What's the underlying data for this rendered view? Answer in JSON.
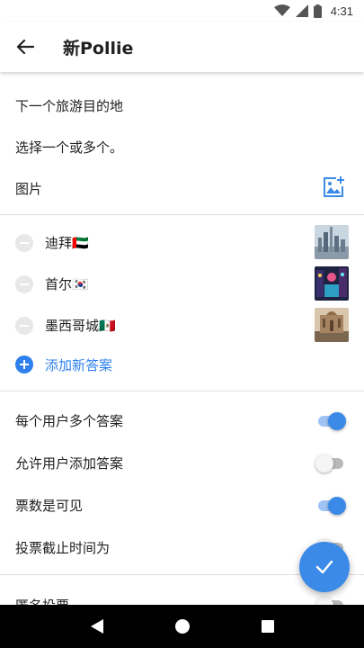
{
  "status_bar": {
    "time": "4:31",
    "icons": [
      "wifi-icon",
      "signal-icon",
      "battery-icon"
    ]
  },
  "app_bar": {
    "title": "新Pollie",
    "back_icon": "back-arrow-icon"
  },
  "poll": {
    "question": "下一个旅游目的地",
    "hint": "选择一个或多个。",
    "image_label": "图片",
    "image_icon": "add-image-icon"
  },
  "answers": [
    {
      "label": "迪拜🇦🇪"
    },
    {
      "label": "首尔🇰🇷"
    },
    {
      "label": "墨西哥城🇲🇽"
    }
  ],
  "add_answer_label": "添加新答案",
  "settings": [
    {
      "label": "每个用户多个答案",
      "on": true
    },
    {
      "label": "允许用户添加答案",
      "on": false
    },
    {
      "label": "票数是可见",
      "on": true
    },
    {
      "label": "投票截止时间为",
      "on": false
    },
    {
      "label": "匿名投票",
      "on": false
    }
  ],
  "fab_icon": "check-icon",
  "nav": [
    "back-triangle-icon",
    "home-circle-icon",
    "recents-square-icon"
  ],
  "colors": {
    "accent": "#3b8ae8",
    "link": "#2f80ed",
    "divider": "#e0e0e0"
  }
}
